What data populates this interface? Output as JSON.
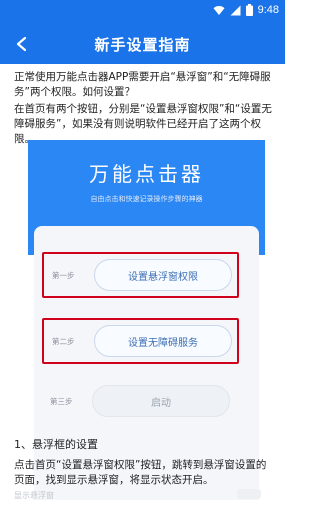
{
  "status_bar": {
    "time": "9:48",
    "icons": [
      "wifi-icon",
      "signal-icon",
      "battery-icon"
    ]
  },
  "app_bar": {
    "title": "新手设置指南",
    "back_icon": "back-arrow-icon"
  },
  "content": {
    "intro": "正常使用万能点击器APP需要开启“悬浮窗”和“无障碍服务”两个权限。如何设置？",
    "instruction": "在首页有两个按钮，分别是“设置悬浮窗权限”和“设置无障碍服务”，如果没有则说明软件已经开启了这两个权限。",
    "guide": {
      "title": "万能点击器",
      "subtitle": "自由点击和快速记录操作步骤的神器",
      "steps": [
        {
          "label": "第一步",
          "button": "设置悬浮窗权限",
          "highlighted": true
        },
        {
          "label": "第二步",
          "button": "设置无障碍服务",
          "highlighted": true
        },
        {
          "label": "第三步",
          "button": "启动",
          "highlighted": false
        }
      ]
    },
    "section_heading": "1、悬浮框的设置",
    "section_body": "点击首页“设置悬浮窗权限”按钮，跳转到悬浮窗设置的页面，找到显示悬浮窗，将显示状态开启。",
    "faded_caption": "显示悬浮窗"
  },
  "colors": {
    "primary": "#1a73e8",
    "guide_blue": "#2b87f3",
    "highlight_red": "#d0021b"
  }
}
